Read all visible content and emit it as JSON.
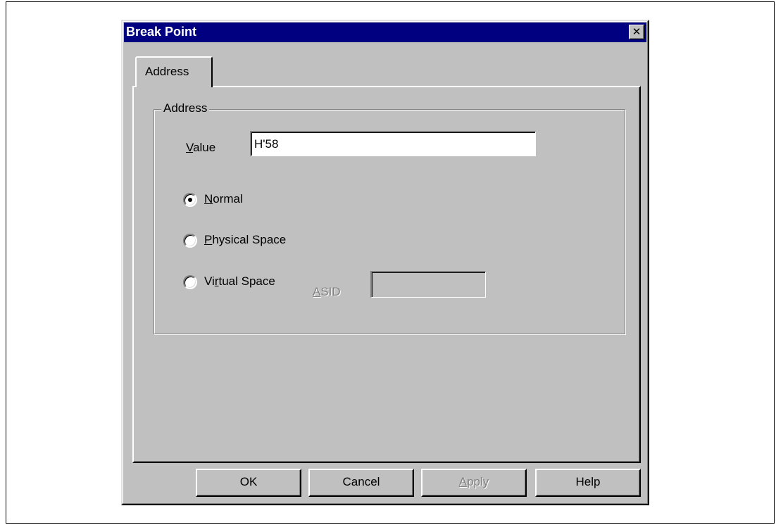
{
  "dialog": {
    "title": "Break Point",
    "close_glyph": "✕"
  },
  "tabs": [
    {
      "label": "Address",
      "selected": true
    }
  ],
  "address_group": {
    "legend": "Address",
    "value_label": "Value",
    "value_mnemonic": "V",
    "value_rest": "alue",
    "value": "H'58",
    "radios": [
      {
        "label": "Normal",
        "mnemonic": "N",
        "rest": "ormal",
        "checked": true
      },
      {
        "label": "Physical Space",
        "mnemonic": "P",
        "rest": "hysical Space",
        "checked": false
      },
      {
        "label": "Virtual Space",
        "prefix": "Vi",
        "mnemonic": "r",
        "rest": "tual Space",
        "checked": false
      }
    ],
    "asid": {
      "label": "ASID",
      "mnemonic": "A",
      "rest": "SID",
      "value": "",
      "enabled": false
    }
  },
  "buttons": {
    "ok": "OK",
    "cancel": "Cancel",
    "apply": "Apply",
    "apply_mnemonic": "A",
    "apply_rest": "pply",
    "help": "Help"
  },
  "colors": {
    "face": "#c0c0c0",
    "titlebar": "#000080",
    "disabled_text": "#808080"
  }
}
